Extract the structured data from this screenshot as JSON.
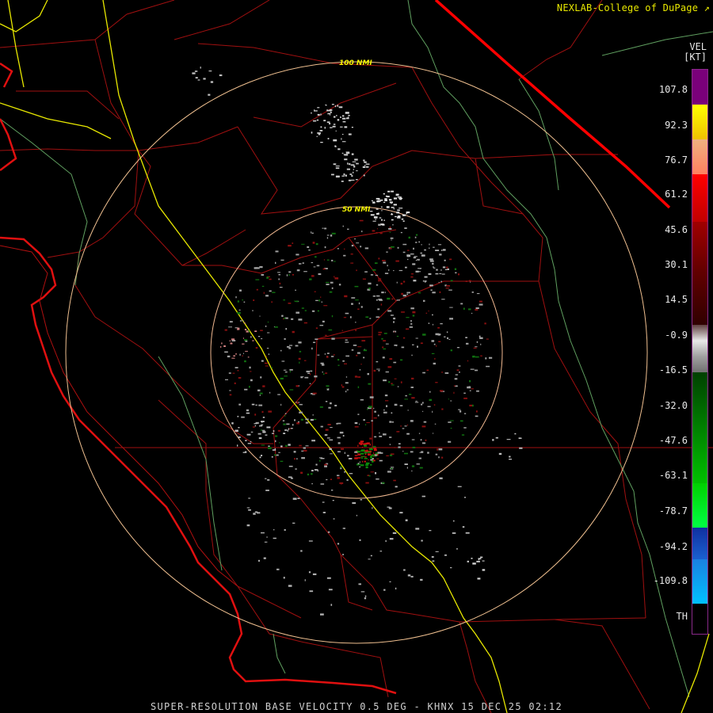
{
  "credit": "NEXLAB-College of DuPage",
  "credit_icon": "external-link-icon",
  "legend": {
    "title_line1": "VEL",
    "title_line2": "[KT]",
    "ticks": [
      "107.8",
      "92.3",
      "76.7",
      "61.2",
      "45.6",
      "30.1",
      "14.5",
      "-0.9",
      "-16.5",
      "-32.0",
      "-47.6",
      "-63.1",
      "-78.7",
      "-94.2",
      "-109.8",
      "TH"
    ],
    "colors": {
      "purple": "#7a007a",
      "yellow": "#ffff00",
      "orange": "#f0a070",
      "red": "#ff0000",
      "dark_red": "#500000",
      "gray": "#c8c8c8",
      "green": "#00aa00",
      "light_green": "#00ff44",
      "blue": "#1a50c8",
      "cyan": "#00b0ff"
    }
  },
  "range_rings": [
    "100 NMI",
    "50 NMI"
  ],
  "footer": "SUPER-RESOLUTION BASE VELOCITY 0.5 DEG - KHNX 15 DEC 25 02:12",
  "map_colors": {
    "county_border": "#a01010",
    "state_border": "#ff0000",
    "coastline": "#e01010",
    "highway": "#e8e800",
    "river": "#60a060",
    "ring": "#f0c090",
    "inner_ring": "#f0b890"
  }
}
